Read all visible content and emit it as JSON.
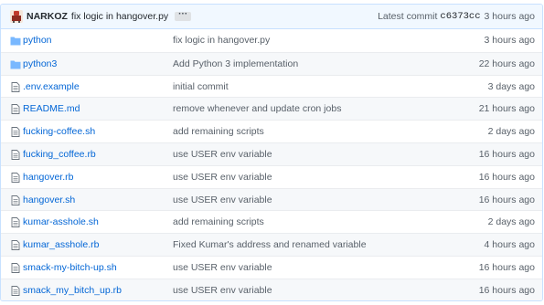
{
  "latest_commit": {
    "author": "NARKOZ",
    "message": "fix logic in hangover.py",
    "ellipsis": "···",
    "label": "Latest commit",
    "sha": "c6373cc",
    "age": "3 hours ago"
  },
  "colors": {
    "header_bg": "#f1f8ff",
    "border": "#c8e1ff",
    "link": "#0366d6",
    "muted": "#586069",
    "folder": "#79b8ff"
  },
  "files": [
    {
      "name": "python",
      "type": "folder",
      "icon": "folder-icon",
      "message": "fix logic in hangover.py",
      "age": "3 hours ago"
    },
    {
      "name": "python3",
      "type": "folder",
      "icon": "folder-icon",
      "message": "Add Python 3 implementation",
      "age": "22 hours ago"
    },
    {
      "name": ".env.example",
      "type": "file",
      "icon": "file-icon",
      "message": "initial commit",
      "age": "3 days ago"
    },
    {
      "name": "README.md",
      "type": "file",
      "icon": "file-icon",
      "message": "remove whenever and update cron jobs",
      "age": "21 hours ago"
    },
    {
      "name": "fucking-coffee.sh",
      "type": "file",
      "icon": "file-icon",
      "message": "add remaining scripts",
      "age": "2 days ago"
    },
    {
      "name": "fucking_coffee.rb",
      "type": "file",
      "icon": "file-icon",
      "message": "use USER env variable",
      "age": "16 hours ago"
    },
    {
      "name": "hangover.rb",
      "type": "file",
      "icon": "file-icon",
      "message": "use USER env variable",
      "age": "16 hours ago"
    },
    {
      "name": "hangover.sh",
      "type": "file",
      "icon": "file-icon",
      "message": "use USER env variable",
      "age": "16 hours ago"
    },
    {
      "name": "kumar-asshole.sh",
      "type": "file",
      "icon": "file-icon",
      "message": "add remaining scripts",
      "age": "2 days ago"
    },
    {
      "name": "kumar_asshole.rb",
      "type": "file",
      "icon": "file-icon",
      "message": "Fixed Kumar's address and renamed variable",
      "age": "4 hours ago"
    },
    {
      "name": "smack-my-bitch-up.sh",
      "type": "file",
      "icon": "file-icon",
      "message": "use USER env variable",
      "age": "16 hours ago"
    },
    {
      "name": "smack_my_bitch_up.rb",
      "type": "file",
      "icon": "file-icon",
      "message": "use USER env variable",
      "age": "16 hours ago"
    }
  ]
}
